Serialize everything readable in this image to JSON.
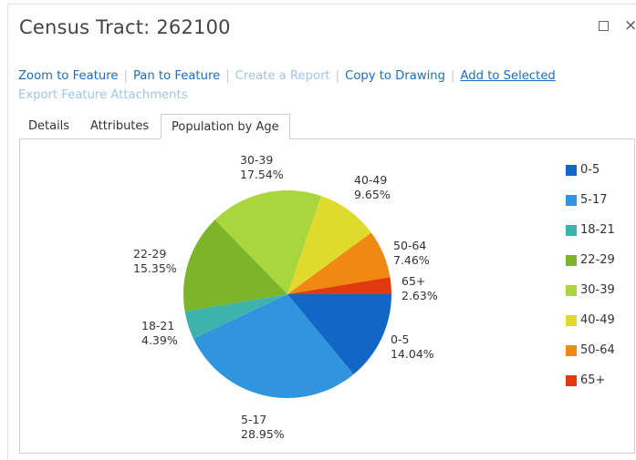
{
  "window": {
    "title": "Census Tract: 262100",
    "close_glyph": "×"
  },
  "actions": [
    {
      "label": "Zoom to Feature",
      "state": "enabled",
      "name": "zoom-to-feature-link"
    },
    {
      "label": "Pan to Feature",
      "state": "enabled",
      "name": "pan-to-feature-link"
    },
    {
      "label": "Create a Report",
      "state": "disabled",
      "name": "create-report-link"
    },
    {
      "label": "Copy to Drawing",
      "state": "enabled",
      "name": "copy-to-drawing-link"
    },
    {
      "label": "Add to Selected",
      "state": "hover",
      "name": "add-to-selected-link"
    },
    {
      "label": "Export Feature Attachments",
      "state": "disabled",
      "name": "export-attachments-link"
    }
  ],
  "tabs": [
    {
      "label": "Details",
      "active": false
    },
    {
      "label": "Attributes",
      "active": false
    },
    {
      "label": "Population by Age",
      "active": true
    }
  ],
  "colors": {
    "link": "#1a6fc4",
    "link_disabled": "#9fc6e8"
  },
  "chart_data": {
    "type": "pie",
    "title": "",
    "categories": [
      "0-5",
      "5-17",
      "18-21",
      "22-29",
      "30-39",
      "40-49",
      "50-64",
      "65+"
    ],
    "values": [
      14.04,
      28.95,
      4.39,
      15.35,
      17.54,
      9.65,
      7.46,
      2.63
    ],
    "value_labels": [
      "14.04%",
      "28.95%",
      "4.39%",
      "15.35%",
      "17.54%",
      "9.65%",
      "7.46%",
      "2.63%"
    ],
    "colors": [
      "#1167c4",
      "#3194dc",
      "#3eb3ad",
      "#7cb42a",
      "#a9d63c",
      "#e0da2c",
      "#f08812",
      "#e13a0c"
    ],
    "legend_position": "right"
  }
}
